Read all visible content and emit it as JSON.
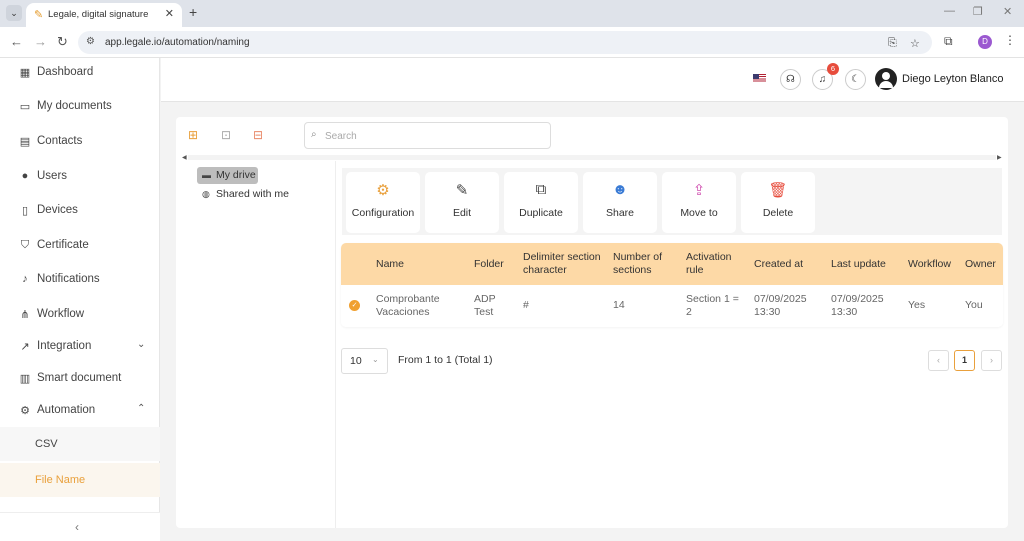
{
  "browser": {
    "tab_title": "Legale, digital signature",
    "url": "app.legale.io/automation/naming",
    "profile_initial": "D"
  },
  "sidebar": {
    "items": [
      {
        "label": "Dashboard",
        "icon": "dashboard-icon"
      },
      {
        "label": "My documents",
        "icon": "folder-icon"
      },
      {
        "label": "Contacts",
        "icon": "contacts-icon"
      },
      {
        "label": "Users",
        "icon": "user-icon"
      },
      {
        "label": "Devices",
        "icon": "tablet-icon"
      },
      {
        "label": "Certificate",
        "icon": "shield-icon"
      },
      {
        "label": "Notifications",
        "icon": "bell-icon"
      },
      {
        "label": "Workflow",
        "icon": "workflow-icon"
      },
      {
        "label": "Integration",
        "icon": "external-link-icon"
      },
      {
        "label": "Smart document",
        "icon": "smart-document-icon"
      },
      {
        "label": "Automation",
        "icon": "automation-icon"
      }
    ],
    "automation_children": [
      "CSV",
      "File Name"
    ],
    "active_child": "File Name",
    "collapse_symbol": "‹"
  },
  "header": {
    "notification_count": "6",
    "user_name": "Diego Leyton Blanco"
  },
  "toolbar": {
    "search_placeholder": "Search"
  },
  "tree": {
    "my_drive": "My drive",
    "shared": "Shared with me"
  },
  "actions": [
    {
      "label": "Configuration",
      "icon": "gear-icon",
      "color": "#e9a03c"
    },
    {
      "label": "Edit",
      "icon": "pen-icon",
      "color": "#444444"
    },
    {
      "label": "Duplicate",
      "icon": "copy-icon",
      "color": "#444444"
    },
    {
      "label": "Share",
      "icon": "user-plus-icon",
      "color": "#3a7bd5"
    },
    {
      "label": "Move to",
      "icon": "folder-move-icon",
      "color": "#d04fb0"
    },
    {
      "label": "Delete",
      "icon": "trash-icon",
      "color": "#e74c3c"
    }
  ],
  "table": {
    "headers": [
      "Name",
      "Folder",
      "Delimiter section character",
      "Number of sections",
      "Activation rule",
      "Created at",
      "Last update",
      "Workflow",
      "Owner"
    ],
    "rows": [
      [
        "Comprobante Vacaciones",
        "ADP Test",
        "#",
        "14",
        "Section 1 = 2",
        "07/09/2025 13:30",
        "07/09/2025 13:30",
        "Yes",
        "You"
      ]
    ]
  },
  "pagination": {
    "page_size": "10",
    "summary": "From 1 to 1 (Total 1)",
    "current_page": "1",
    "prev": "‹",
    "next": "›"
  },
  "colors": {
    "accent": "#e9a03c",
    "table_header": "#fdd9a6"
  }
}
